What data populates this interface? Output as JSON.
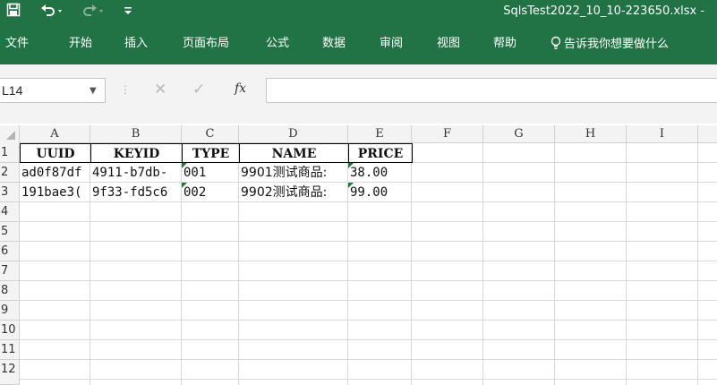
{
  "titlebar": {
    "save_icon": "save-icon",
    "undo_icon": "undo-icon",
    "redo_icon": "redo-icon",
    "customize_icon": "customize-qat-icon",
    "filename": "SqlsTest2022_10_10-223650.xlsx -"
  },
  "ribbon": {
    "tabs": [
      "文件",
      "开始",
      "插入",
      "页面布局",
      "公式",
      "数据",
      "审阅",
      "视图",
      "帮助"
    ],
    "tell_me": "告诉我你想要做什么"
  },
  "formula_bar": {
    "name_box": "L14",
    "cancel_glyph": "✕",
    "enter_glyph": "✓",
    "fx_label": "fx",
    "formula": ""
  },
  "sheet": {
    "columns": [
      "A",
      "B",
      "C",
      "D",
      "E",
      "F",
      "G",
      "H",
      "I"
    ],
    "rows": [
      "1",
      "2",
      "3",
      "4",
      "5",
      "6",
      "7",
      "8",
      "9",
      "10",
      "11",
      "12"
    ],
    "header_cells": [
      "UUID",
      "KEYID",
      "TYPE",
      "NAME",
      "PRICE"
    ],
    "data_rows": [
      [
        "ad0f87df",
        "4911-b7db-",
        "001",
        "9901测试商品:",
        "38.00"
      ],
      [
        "191bae3(",
        "9f33-fd5c6",
        "002",
        "9902测试商品:",
        "99.00"
      ]
    ]
  },
  "colors": {
    "accent": "#217346",
    "error_indicator": "#1e7b34"
  }
}
